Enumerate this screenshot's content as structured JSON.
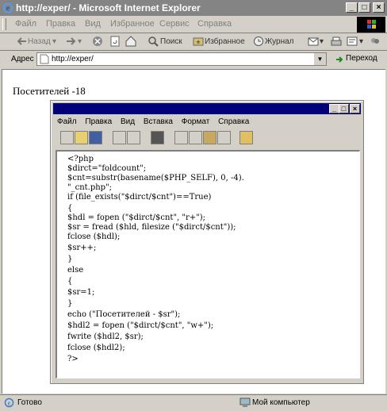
{
  "window": {
    "title": "http://exper/ - Microsoft Internet Explorer"
  },
  "menu": [
    "Файл",
    "Правка",
    "Вид",
    "Избранное",
    "Сервис",
    "Справка"
  ],
  "toolbar": {
    "back": "Назад",
    "search": "Поиск",
    "favorites": "Избранное",
    "journal": "Журнал"
  },
  "address": {
    "label": "Адрес",
    "value": "http://exper/",
    "go": "Переход"
  },
  "page": {
    "visitors": "Посетителей -18"
  },
  "editor": {
    "menu": [
      "Файл",
      "Правка",
      "Вид",
      "Вставка",
      "Формат",
      "Справка"
    ],
    "lines": [
      "<?php",
      "$dirct=\"foldcount\";",
      "$cnt=substr(basename($PHP_SELF), 0, -4).",
      "\"_cnt.php\";",
      "if (file_exists(\"$dirct/$cnt\")==True)",
      "{",
      "$hdl = fopen (\"$dirct/$cnt\", \"r+\");",
      "$sr = fread ($hld, filesize (\"$dirct/$cnt\"));",
      "fclose ($hdl);",
      "$sr++;",
      "}",
      "else",
      "{",
      "$sr=1;",
      "}",
      "echo (\"Посетителей - $sr\");",
      "$hdl2 = fopen (\"$dirct/$cnt\", \"w+\");",
      "fwrite ($hdl2, $sr);",
      "fclose ($hdl2);",
      "?>"
    ]
  },
  "status": {
    "text": "Готово",
    "zone": "Мой компьютер"
  }
}
